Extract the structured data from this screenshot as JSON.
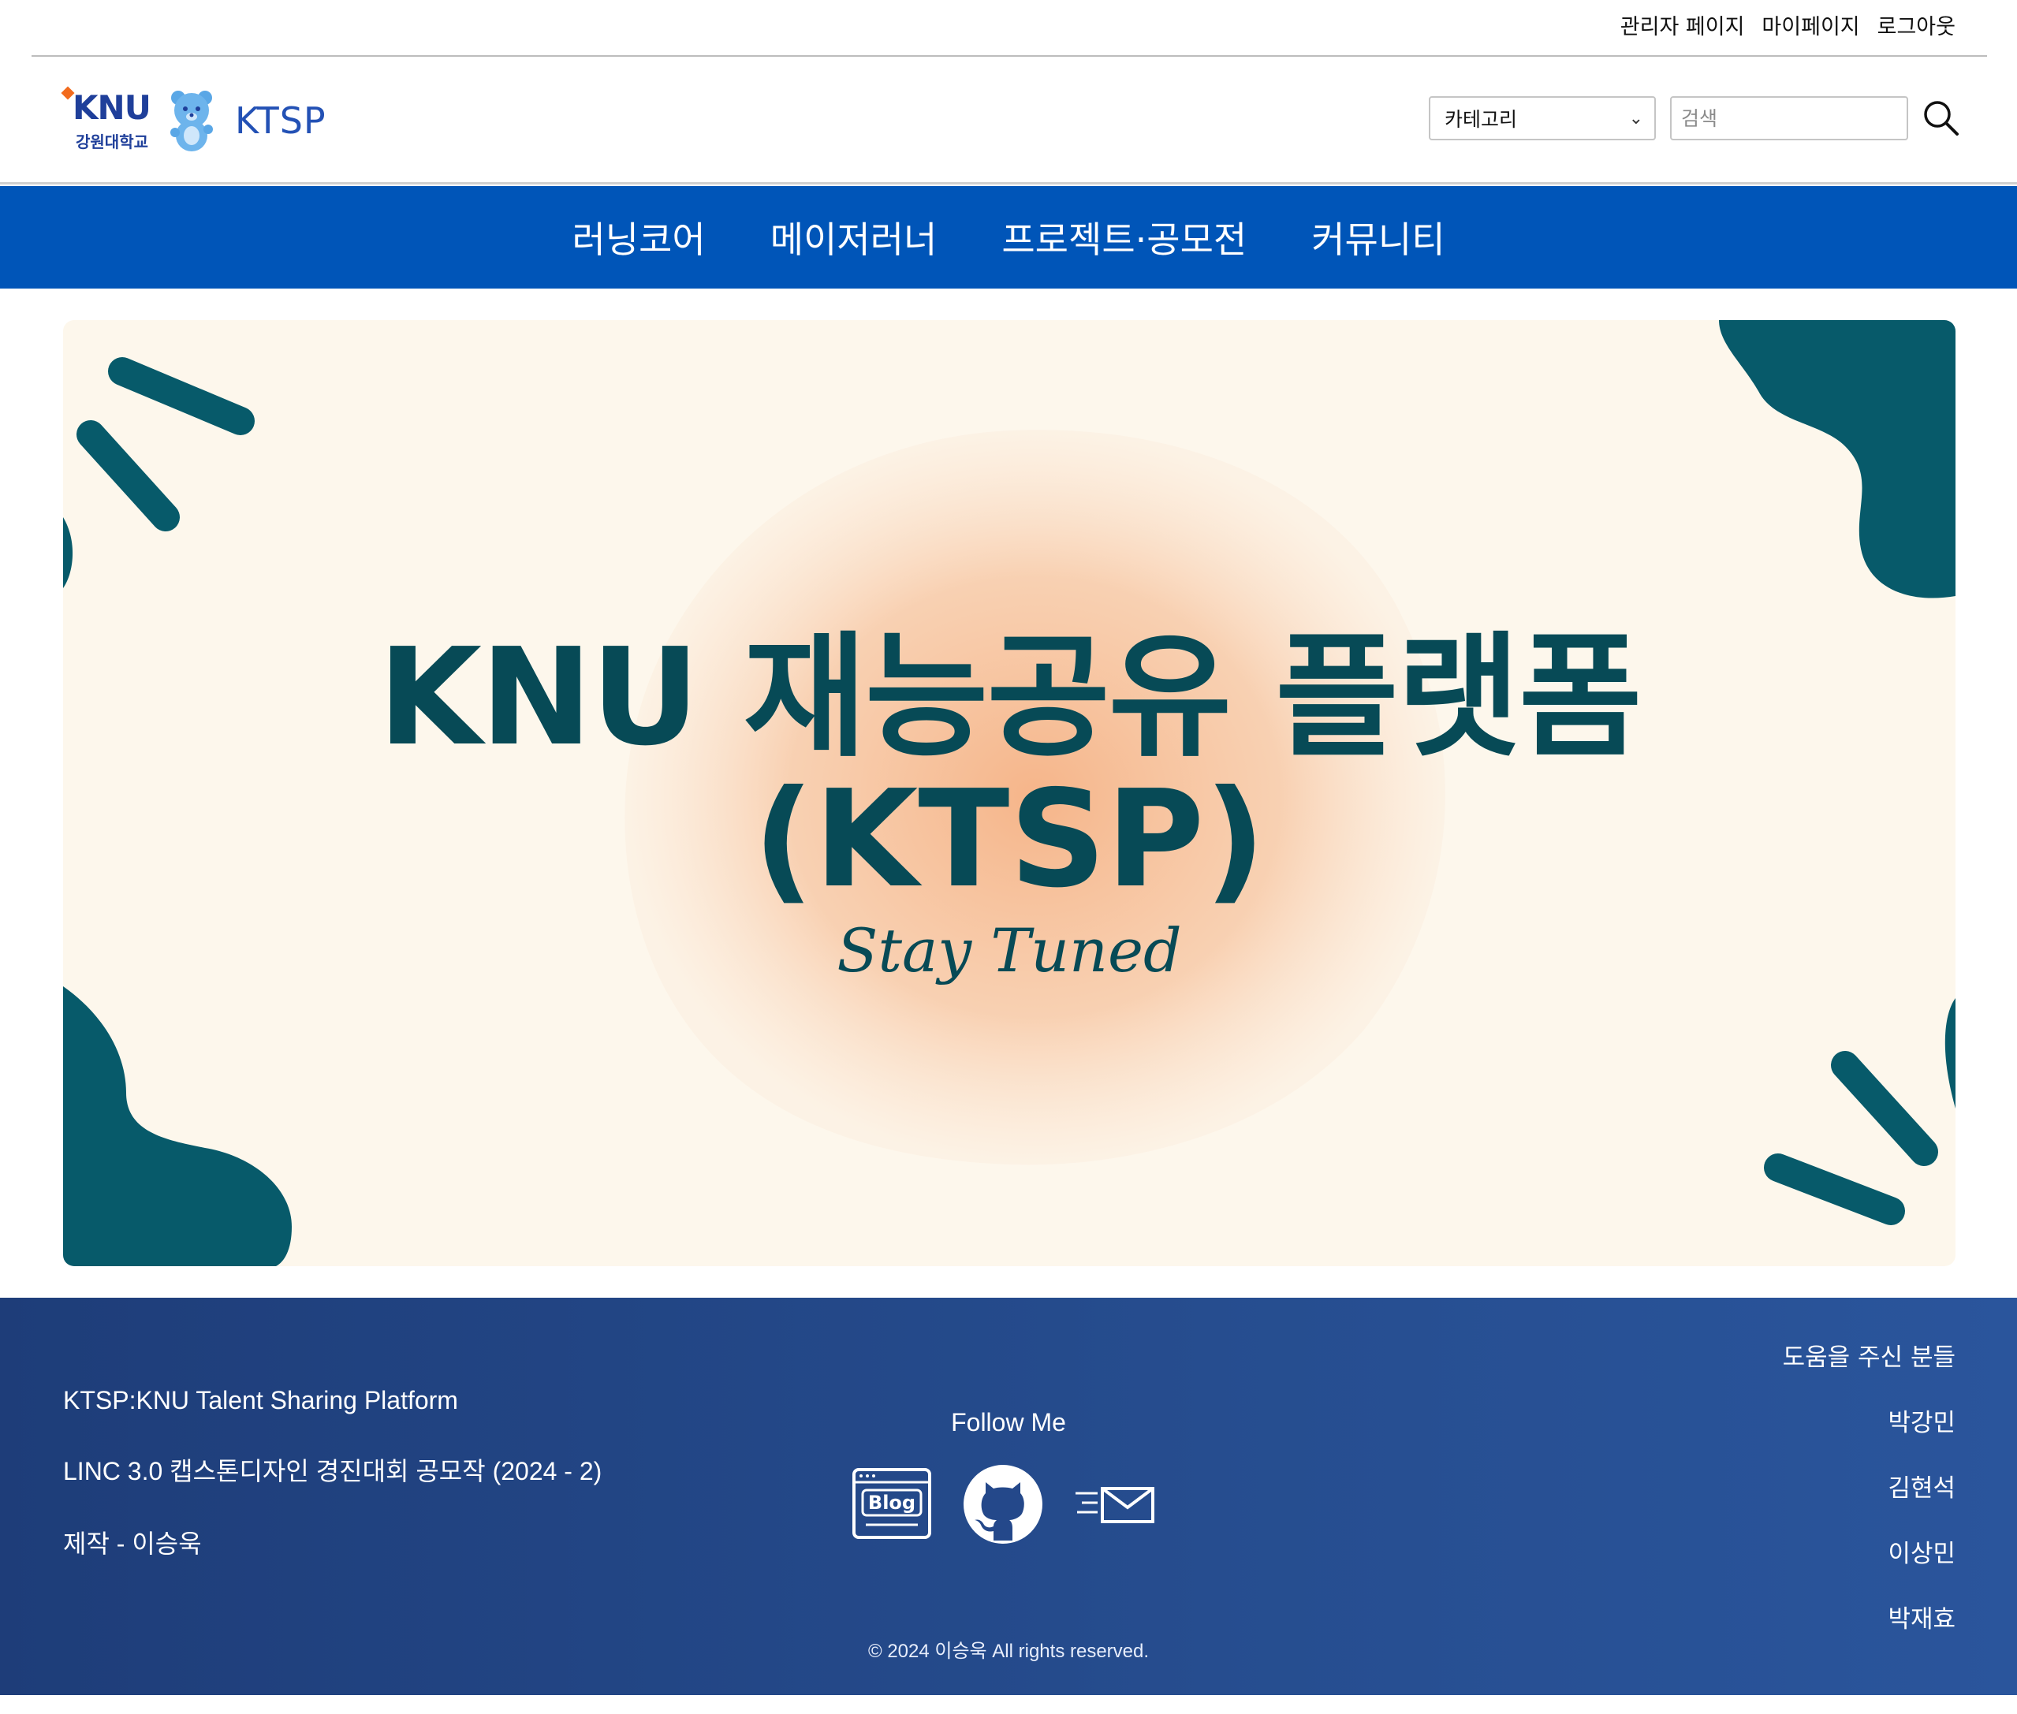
{
  "topbar": {
    "links": [
      "관리자 페이지",
      "마이페이지",
      "로그아웃"
    ]
  },
  "header": {
    "logo": {
      "mark": "KNU",
      "sub": "강원대학교",
      "site_name": "KTSP"
    },
    "category_select": "카테고리",
    "search_placeholder": "검색",
    "search_icon": "search-icon"
  },
  "nav": {
    "items": [
      "러닝코어",
      "메이저러너",
      "프로젝트·공모전",
      "커뮤니티"
    ]
  },
  "banner": {
    "title_line1": "KNU 재능공유 플랫폼",
    "title_line2": "(KTSP)",
    "tagline": "Stay Tuned",
    "colors": {
      "background": "#fdf7ec",
      "accent": "#074a56",
      "blob": "#f4b98e"
    }
  },
  "footer": {
    "left": [
      "KTSP:KNU Talent Sharing Platform",
      "LINC 3.0 캡스톤디자인 경진대회 공모작 (2024 - 2)",
      "제작 - 이승욱"
    ],
    "follow_label": "Follow Me",
    "social": [
      "blog-icon",
      "github-icon",
      "mail-icon"
    ],
    "blog_label": "Blog",
    "thanks_title": "도움을 주신 분들",
    "thanks": [
      "박강민",
      "김현석",
      "이상민",
      "박재효"
    ],
    "copyright": "© 2024 이승욱 All rights reserved."
  },
  "colors": {
    "nav": "#0055b8",
    "footer": "#24488a",
    "brand": "#1f3f9a"
  }
}
